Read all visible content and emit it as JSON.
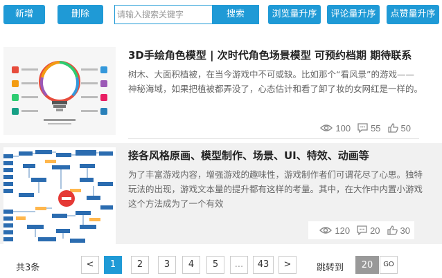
{
  "toolbar": {
    "add_label": "新增",
    "delete_label": "删除",
    "search_placeholder": "请输入搜索关键字",
    "search_value": "",
    "search_label": "搜索",
    "sort_view_label": "浏览量升序",
    "sort_comment_label": "评论量升序",
    "sort_like_label": "点赞量升序"
  },
  "items": [
    {
      "title": "3D手绘角色模型 | 次时代角色场景模型 可预约档期 期待联系",
      "description": "树木、大面积植被，在当今游戏中不可或缺。比如那个“看风景”的游戏——神秘海域，如果把植被都弄没了，心态估计和看了卸了妆的女网红是一样的。",
      "thumbnail_icon": "business-idea-infographic-image",
      "views": "100",
      "comments": "55",
      "likes": "50"
    },
    {
      "title": "接各风格原画、模型制作、场景、UI、特效、动画等",
      "description": "为了丰富游戏内容，增强游戏的趣味性，游戏制作者们可谓花尽了心思。独特玩法的出现，游戏文本量的提升都有这样的考量。其中，在大作中内置小游戏这个方法成为了一个有效",
      "thumbnail_icon": "flowchart-diagram-image",
      "views": "120",
      "comments": "20",
      "likes": "30"
    }
  ],
  "pagination": {
    "total": "共3条",
    "prev": "<",
    "pages": [
      "1",
      "2",
      "3",
      "4",
      "5"
    ],
    "ellipsis": "...",
    "last": "43",
    "next": ">",
    "jump_label": "跳转到",
    "jump_value": "20",
    "go_label": "GO"
  },
  "colors": {
    "accent": "#1f9ad6",
    "alt_row_bg": "#f1f1f1"
  }
}
